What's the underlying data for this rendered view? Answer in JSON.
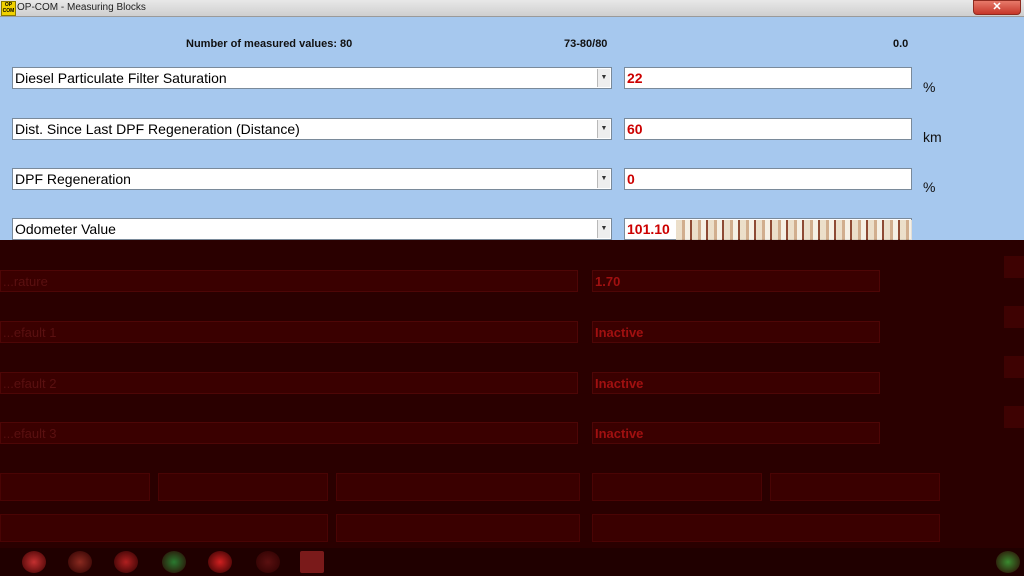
{
  "window": {
    "icon_text": "OP COM",
    "title": "OP-COM - Measuring Blocks",
    "close_glyph": "✕"
  },
  "header": {
    "measured_count": "Number of measured values: 80",
    "range": "73-80/80",
    "time": "0.0"
  },
  "rows": [
    {
      "label": "Diesel Particulate Filter Saturation",
      "value": "22",
      "unit": "%"
    },
    {
      "label": "Dist. Since Last DPF Regeneration (Distance)",
      "value": "60",
      "unit": "km"
    },
    {
      "label": "DPF Regeneration",
      "value": "0",
      "unit": "%"
    },
    {
      "label": "Odometer Value",
      "value": "101.10",
      "unit": ""
    }
  ],
  "dark_rows": [
    {
      "label": "...rature",
      "value": "1.70"
    },
    {
      "label": "...efault 1",
      "value": "Inactive"
    },
    {
      "label": "...efault 2",
      "value": "Inactive"
    },
    {
      "label": "...efault 3",
      "value": "Inactive"
    }
  ],
  "colors": {
    "client_bg": "#a6c8ee",
    "value_text": "#cc0000",
    "corrupted_bg": "#2a0000"
  },
  "icons": {
    "dropdown": "chevron-down-icon",
    "close": "close-icon"
  }
}
